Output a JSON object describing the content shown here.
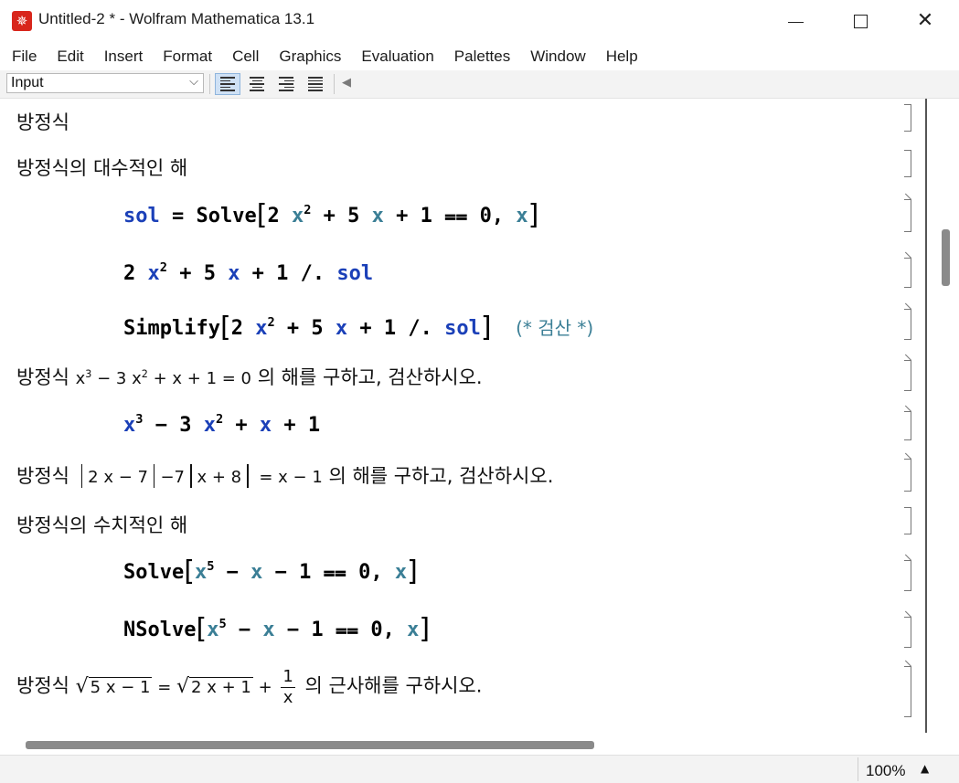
{
  "window": {
    "title": "Untitled-2 * - Wolfram Mathematica 13.1",
    "icon": "mathematica-spikey-icon",
    "controls": {
      "minimize": "minimize",
      "maximize": "maximize",
      "close": "✕"
    }
  },
  "menu": [
    "File",
    "Edit",
    "Insert",
    "Format",
    "Cell",
    "Graphics",
    "Evaluation",
    "Palettes",
    "Window",
    "Help"
  ],
  "toolbar": {
    "style_value": "Input",
    "align_buttons": [
      "align-left",
      "align-center",
      "align-right",
      "align-justify"
    ],
    "active_align": "align-left"
  },
  "cells": {
    "t1": "방정식",
    "t2": "방정식의 대수적인 해",
    "in1": {
      "a": "sol",
      "b": " = Solve",
      "c": "2 ",
      "x1": "x",
      "sq": "2",
      "d": " + 5 ",
      "x2": "x",
      "e": " + 1 ⩵ 0, ",
      "x3": "x"
    },
    "in2": {
      "a": "2 ",
      "x1": "x",
      "sq": "2",
      "b": " + 5 ",
      "x2": "x",
      "c": " + 1 /. ",
      "sol": "sol"
    },
    "in3": {
      "fn": "Simplify",
      "a": "2 ",
      "x1": "x",
      "sq": "2",
      "b": " + 5 ",
      "x2": "x",
      "c": " + 1 /. ",
      "sol": "sol",
      "comment": "(* 검산 *)"
    },
    "t3": {
      "pre": "방정식 ",
      "m1": "x",
      "e1": "3",
      "m2": " − 3 x",
      "e2": "2",
      "m3": " + x + 1 = 0",
      "post": " 의 해를 구하고, 검산하시오."
    },
    "in4": {
      "x1": "x",
      "e1": "3",
      "a": " − 3 ",
      "x2": "x",
      "e2": "2",
      "b": " + ",
      "x3": "x",
      "c": " + 1"
    },
    "t4": {
      "pre": "방정식 ",
      "m1": "2 x − 7",
      "m2": "−7",
      "m3": "x + 8",
      "m4": " = x − 1",
      "post": " 의 해를 구하고, 검산하시오."
    },
    "t5": "방정식의 수치적인 해",
    "in5": {
      "fn": "Solve",
      "x1": "x",
      "e1": "5",
      "a": " − ",
      "x2": "x",
      "b": " − 1 ⩵ 0, ",
      "x3": "x"
    },
    "in6": {
      "fn": "NSolve",
      "x1": "x",
      "e1": "5",
      "a": " − ",
      "x2": "x",
      "b": " − 1 ⩵ 0, ",
      "x3": "x"
    },
    "t6": {
      "pre": "방정식 ",
      "r1": "5 x − 1",
      "eq": " = ",
      "r2": "2 x + 1",
      "plus": " + ",
      "num": "1",
      "den": "x",
      "post": " 의 근사해를 구하시오."
    }
  },
  "status": {
    "zoom": "100%",
    "zoom_arrow": "▲"
  }
}
